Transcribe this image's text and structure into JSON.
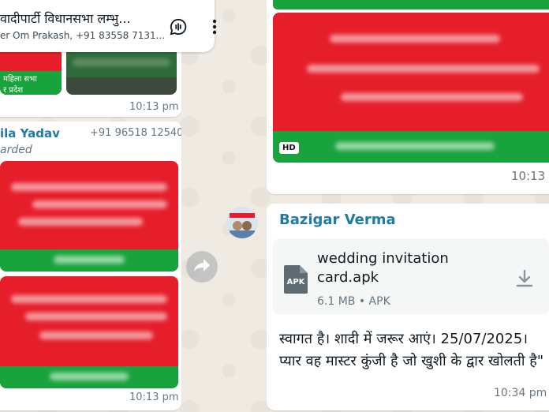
{
  "header": {
    "title": "वादीपार्टी विधानसभा लम्भु...",
    "subtitle": "er Om Prakash, +91 83558 7131..."
  },
  "left": {
    "top_image_texts": [
      "महिला सभा",
      "र प्रदेश"
    ],
    "top_time": "10:13 pm",
    "sender_name": "ila Yadav",
    "sender_phone": "+91 96518 12540",
    "forwarded_label": "arded",
    "bottom_time": "10:13 pm"
  },
  "right": {
    "hd_label": "HD",
    "top_time": "10:13",
    "sender_name": "Bazigar Verma",
    "file": {
      "name": "wedding invitation card.apk",
      "icon_label": "APK",
      "meta": "6.1 MB • APK"
    },
    "message_text": "स्वागत है। शादी में जरूर आएं। 25/07/2025। प्यार वह मास्टर कुंजी है जो खुशी के द्वार खोलती है\"",
    "message_time": "10:34 pm"
  },
  "colors": {
    "chat_bg": "#efeae2",
    "sender_blue": "#1f7aa8",
    "banner_red": "#e61e2a",
    "banner_green": "#19a33c"
  },
  "icons": [
    "voice-chat-icon",
    "more-options-icon",
    "forward-icon",
    "apk-file-icon",
    "download-icon"
  ]
}
